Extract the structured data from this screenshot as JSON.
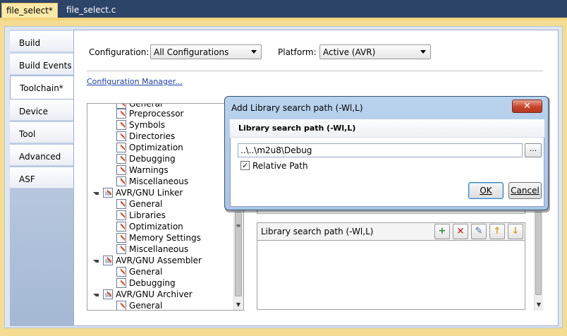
{
  "doc_tabs": [
    {
      "label": "file_select*",
      "active": true
    },
    {
      "label": "file_select.c",
      "active": false
    }
  ],
  "side_tabs": [
    "Build",
    "Build Events",
    "Toolchain*",
    "Device",
    "Tool",
    "Advanced",
    "ASF"
  ],
  "active_side_tab": "Toolchain*",
  "configuration": {
    "label": "Configuration:",
    "value": "All Configurations"
  },
  "platform": {
    "label": "Platform:",
    "value": "Active (AVR)"
  },
  "config_manager_link": "Configuration Manager...",
  "tree": {
    "items": [
      {
        "label": "General",
        "level": 1
      },
      {
        "label": "Preprocessor",
        "level": 1
      },
      {
        "label": "Symbols",
        "level": 1
      },
      {
        "label": "Directories",
        "level": 1
      },
      {
        "label": "Optimization",
        "level": 1
      },
      {
        "label": "Debugging",
        "level": 1
      },
      {
        "label": "Warnings",
        "level": 1
      },
      {
        "label": "Miscellaneous",
        "level": 1
      },
      {
        "label": "AVR/GNU Linker",
        "level": 0
      },
      {
        "label": "General",
        "level": 1
      },
      {
        "label": "Libraries",
        "level": 1
      },
      {
        "label": "Optimization",
        "level": 1
      },
      {
        "label": "Memory Settings",
        "level": 1
      },
      {
        "label": "Miscellaneous",
        "level": 1
      },
      {
        "label": "AVR/GNU Assembler",
        "level": 0
      },
      {
        "label": "General",
        "level": 1
      },
      {
        "label": "Debugging",
        "level": 1
      },
      {
        "label": "AVR/GNU Archiver",
        "level": 0
      },
      {
        "label": "General",
        "level": 1
      }
    ]
  },
  "library_panel": {
    "title": "Library search path (-Wl,L)",
    "toolbar_icons": [
      "add-item-icon",
      "delete-item-icon",
      "edit-item-icon",
      "move-up-icon",
      "move-down-icon"
    ]
  },
  "dialog": {
    "title": "Add Library search path (-Wl,L)",
    "close_label": "✕",
    "header": "Library search path (-Wl,L)",
    "path_value": "..\\..\\m2u8\\Debug",
    "browse_label": "...",
    "relative_path_label": "Relative Path",
    "relative_path_checked": true,
    "ok_label": "OK",
    "cancel_label": "Cancel"
  }
}
